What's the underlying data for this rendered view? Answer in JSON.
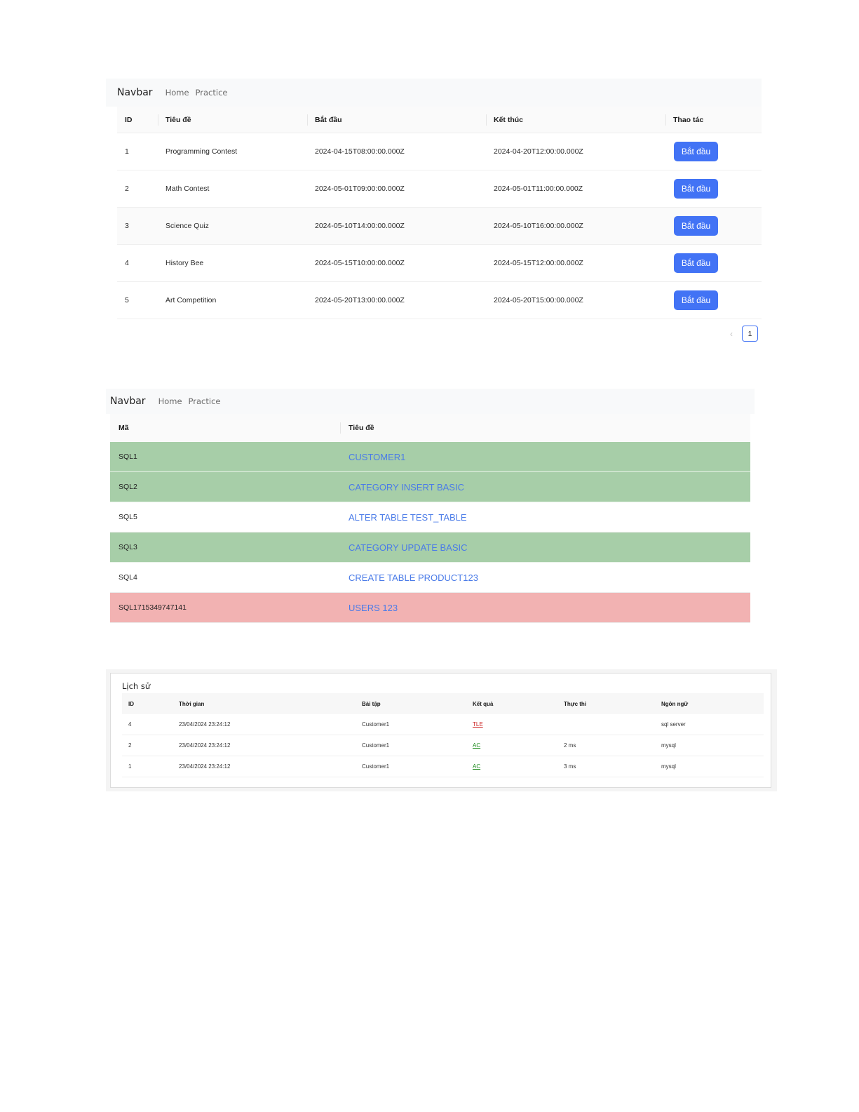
{
  "section1": {
    "navbar": {
      "brand": "Navbar",
      "links": [
        "Home",
        "Practice"
      ]
    },
    "table": {
      "headers": [
        "ID",
        "Tiêu đề",
        "Bắt đầu",
        "Kết thúc",
        "Thao tác"
      ],
      "rows": [
        {
          "id": "1",
          "title": "Programming Contest",
          "start": "2024-04-15T08:00:00.000Z",
          "end": "2024-04-20T12:00:00.000Z",
          "action": "Bắt đầu"
        },
        {
          "id": "2",
          "title": "Math Contest",
          "start": "2024-05-01T09:00:00.000Z",
          "end": "2024-05-01T11:00:00.000Z",
          "action": "Bắt đầu"
        },
        {
          "id": "3",
          "title": "Science Quiz",
          "start": "2024-05-10T14:00:00.000Z",
          "end": "2024-05-10T16:00:00.000Z",
          "action": "Bắt đầu"
        },
        {
          "id": "4",
          "title": "History Bee",
          "start": "2024-05-15T10:00:00.000Z",
          "end": "2024-05-15T12:00:00.000Z",
          "action": "Bắt đầu"
        },
        {
          "id": "5",
          "title": "Art Competition",
          "start": "2024-05-20T13:00:00.000Z",
          "end": "2024-05-20T15:00:00.000Z",
          "action": "Bắt đầu"
        }
      ]
    },
    "pagination": {
      "prev_icon": "chevron-left-icon",
      "prev_glyph": "‹",
      "current_page": "1"
    }
  },
  "section2": {
    "navbar": {
      "brand": "Navbar",
      "links": [
        "Home",
        "Practice"
      ]
    },
    "table": {
      "headers": [
        "Mã",
        "Tiêu đề"
      ],
      "rows": [
        {
          "code": "SQL1",
          "title": "CUSTOMER1"
        },
        {
          "code": "SQL2",
          "title": "CATEGORY INSERT BASIC"
        },
        {
          "code": "SQL5",
          "title": "ALTER TABLE TEST_TABLE"
        },
        {
          "code": "SQL3",
          "title": "CATEGORY UPDATE BASIC"
        },
        {
          "code": "SQL4",
          "title": "CREATE TABLE PRODUCT123"
        },
        {
          "code": "SQL1715349747141",
          "title": "USERS 123"
        }
      ]
    },
    "colors": {
      "solved": "#a7cea8",
      "failed": "#f2b2b2",
      "link": "#4a7be8"
    }
  },
  "section3": {
    "title": "Lịch sử",
    "table": {
      "headers": [
        "ID",
        "Thời gian",
        "Bài tập",
        "Kết quả",
        "Thực thi",
        "Ngôn ngữ"
      ],
      "rows": [
        {
          "id": "4",
          "time": "23/04/2024 23:24:12",
          "exercise": "Customer1",
          "result": "TLE",
          "exec": "",
          "lang": "sql server"
        },
        {
          "id": "2",
          "time": "23/04/2024 23:24:12",
          "exercise": "Customer1",
          "result": "AC",
          "exec": "2 ms",
          "lang": "mysql"
        },
        {
          "id": "1",
          "time": "23/04/2024 23:24:12",
          "exercise": "Customer1",
          "result": "AC",
          "exec": "3 ms",
          "lang": "mysql"
        }
      ]
    },
    "colors": {
      "tle": "#cc2222",
      "ac": "#1b8a1b"
    }
  },
  "colors": {
    "primary": "#4273f5",
    "navbar_bg": "#f8f9fa"
  }
}
